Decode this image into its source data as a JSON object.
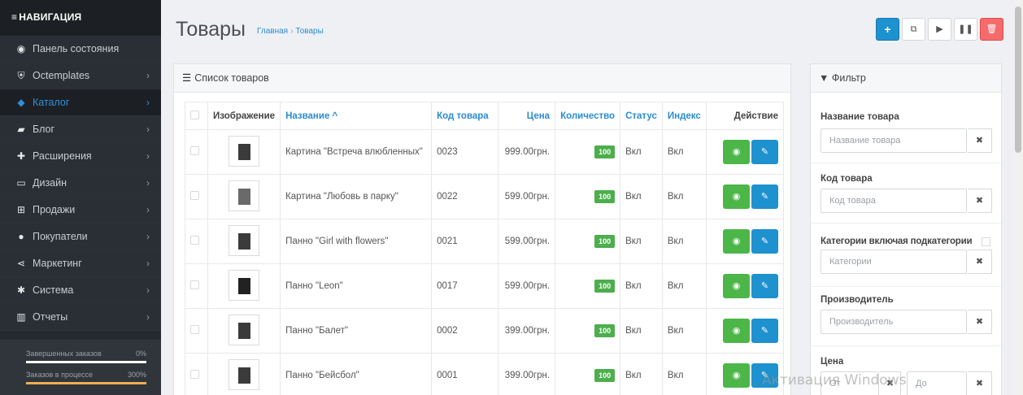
{
  "sidebar": {
    "title": "НАВИГАЦИЯ",
    "items": [
      {
        "label": "Панель состояния",
        "icon": "dashboard-icon",
        "glyph": "◉"
      },
      {
        "label": "Octemplates",
        "icon": "shield-icon",
        "glyph": "⛨"
      },
      {
        "label": "Каталог",
        "icon": "tag-icon",
        "glyph": "◆"
      },
      {
        "label": "Блог",
        "icon": "book-icon",
        "glyph": "▰"
      },
      {
        "label": "Расширения",
        "icon": "puzzle-icon",
        "glyph": "✚"
      },
      {
        "label": "Дизайн",
        "icon": "monitor-icon",
        "glyph": "▭"
      },
      {
        "label": "Продажи",
        "icon": "cart-icon",
        "glyph": "⊞"
      },
      {
        "label": "Покупатели",
        "icon": "user-icon",
        "glyph": "●"
      },
      {
        "label": "Маркетинг",
        "icon": "share-icon",
        "glyph": "⋖"
      },
      {
        "label": "Система",
        "icon": "cog-icon",
        "glyph": "✱"
      },
      {
        "label": "Отчеты",
        "icon": "bar-chart-icon",
        "glyph": "▥"
      }
    ],
    "active_index": 2,
    "stats": [
      {
        "label": "Завершенных заказов",
        "value": "0%",
        "fill_fraction": 1.0,
        "color": "#ffffff"
      },
      {
        "label": "Заказов в процессе",
        "value": "300%",
        "fill_fraction": 1.0,
        "color": "#f0ad4e"
      }
    ]
  },
  "header": {
    "title": "Товары",
    "breadcrumb": [
      "Главная",
      "Товары"
    ],
    "toolbar": [
      {
        "name": "add-button",
        "icon": "plus-icon",
        "glyph": "+"
      },
      {
        "name": "copy-button",
        "icon": "copy-icon",
        "glyph": "⧉"
      },
      {
        "name": "enable-button",
        "icon": "play-icon",
        "glyph": "▶"
      },
      {
        "name": "disable-button",
        "icon": "pause-icon",
        "glyph": "❚❚"
      },
      {
        "name": "delete-button",
        "icon": "trash-icon",
        "glyph": "🗑"
      }
    ]
  },
  "product_list": {
    "title": "Список товаров",
    "columns": {
      "image": "Изображение",
      "name": "Название ^",
      "model": "Код товара",
      "price": "Цена",
      "quantity": "Количество",
      "status": "Статус",
      "index": "Индекс",
      "action": "Действие"
    },
    "rows": [
      {
        "name": "Картина \"Встреча влюбленных\"",
        "model": "0023",
        "price": "999.00грн.",
        "quantity": "100",
        "status": "Вкл",
        "index": "Вкл"
      },
      {
        "name": "Картина \"Любовь в парку\"",
        "model": "0022",
        "price": "599.00грн.",
        "quantity": "100",
        "status": "Вкл",
        "index": "Вкл"
      },
      {
        "name": "Панно \"Girl with flowers\"",
        "model": "0021",
        "price": "599.00грн.",
        "quantity": "100",
        "status": "Вкл",
        "index": "Вкл"
      },
      {
        "name": "Панно \"Leon\"",
        "model": "0017",
        "price": "599.00грн.",
        "quantity": "100",
        "status": "Вкл",
        "index": "Вкл"
      },
      {
        "name": "Панно \"Балет\"",
        "model": "0002",
        "price": "399.00грн.",
        "quantity": "100",
        "status": "Вкл",
        "index": "Вкл"
      },
      {
        "name": "Панно \"Бейсбол\"",
        "model": "0001",
        "price": "399.00грн.",
        "quantity": "100",
        "status": "Вкл",
        "index": "Вкл"
      }
    ]
  },
  "filter": {
    "title": "Фильтр",
    "fields": {
      "name_label": "Название товара",
      "name_placeholder": "Название товара",
      "model_label": "Код товара",
      "model_placeholder": "Код товара",
      "category_label": "Категории  включая подкатегории",
      "category_placeholder": "Категории",
      "manufacturer_label": "Производитель",
      "manufacturer_placeholder": "Производитель",
      "price_label": "Цена",
      "price_from_placeholder": "От",
      "price_to_placeholder": "До"
    }
  },
  "watermark": "Активация Windows"
}
